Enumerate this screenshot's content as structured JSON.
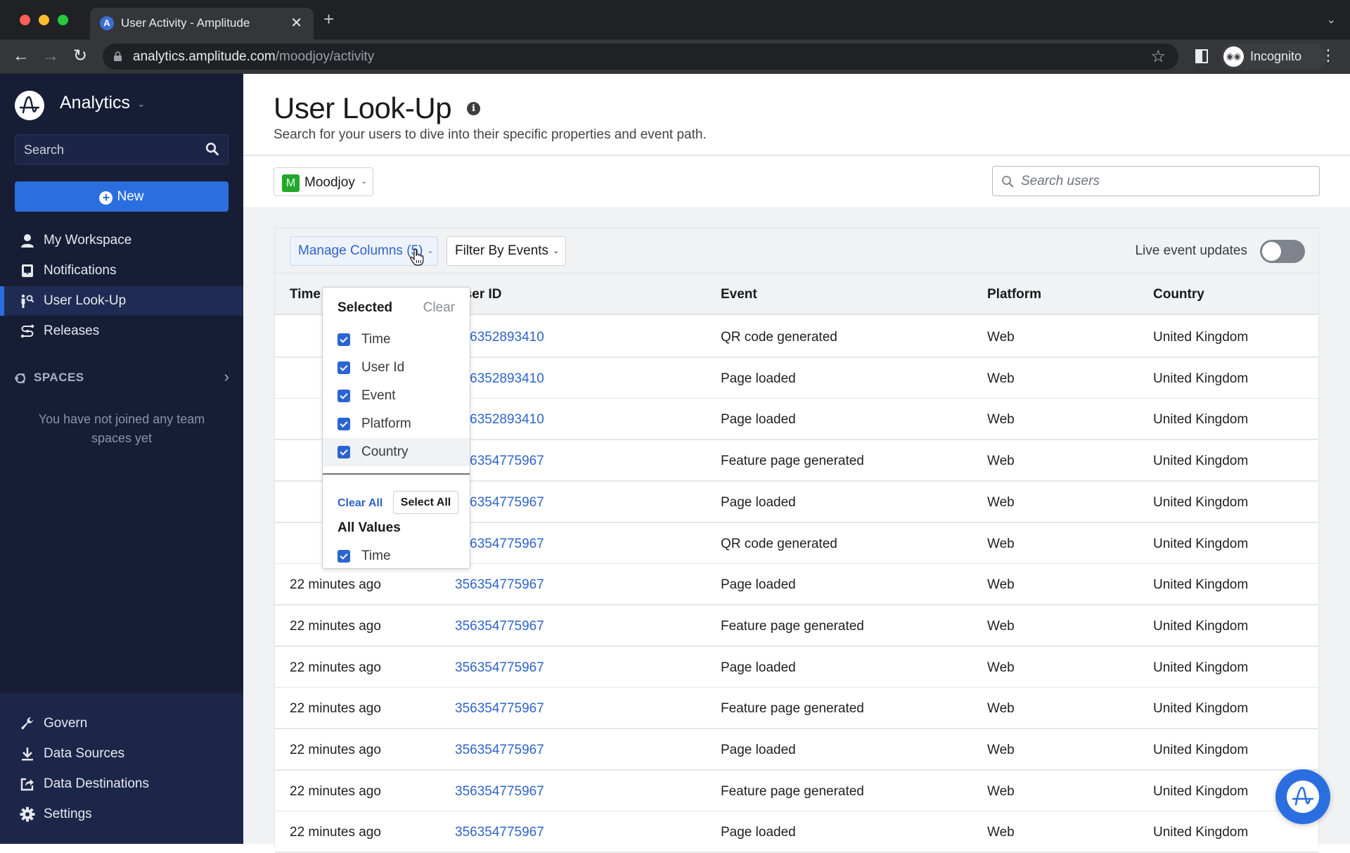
{
  "browser": {
    "tab_title": "User Activity - Amplitude",
    "url_host": "analytics.amplitude.com",
    "url_path": "/moodjoy/activity",
    "profile_label": "Incognito",
    "traffic_colors": {
      "close": "#ff5f57",
      "minimize": "#febc2e",
      "maximize": "#28c840"
    }
  },
  "sidebar": {
    "app_name": "Analytics",
    "search_placeholder": "Search",
    "new_button": "New",
    "nav": [
      {
        "label": "My Workspace",
        "icon": "user-icon"
      },
      {
        "label": "Notifications",
        "icon": "inbox-icon"
      },
      {
        "label": "User Look-Up",
        "icon": "user-search-icon",
        "active": true
      },
      {
        "label": "Releases",
        "icon": "releases-icon"
      }
    ],
    "spaces_label": "SPACES",
    "spaces_empty": "You have not joined any team spaces yet",
    "bottom_nav": [
      {
        "label": "Govern",
        "icon": "wrench-icon"
      },
      {
        "label": "Data Sources",
        "icon": "download-icon"
      },
      {
        "label": "Data Destinations",
        "icon": "export-icon"
      },
      {
        "label": "Settings",
        "icon": "gear-icon"
      }
    ]
  },
  "main": {
    "title": "User Look-Up",
    "subtitle": "Search for your users to dive into their specific properties and event path.",
    "project": {
      "badge": "M",
      "name": "Moodjoy",
      "badge_color": "#22a82a"
    },
    "search_placeholder": "Search users",
    "toolbar": {
      "manage_columns": "Manage Columns (5)",
      "filter_events": "Filter By Events",
      "live_updates_label": "Live event updates",
      "live_updates_on": false
    },
    "columns_dropdown": {
      "selected_title": "Selected",
      "clear": "Clear",
      "selected": [
        "Time",
        "User Id",
        "Event",
        "Platform",
        "Country"
      ],
      "clear_all": "Clear All",
      "select_all": "Select All",
      "all_values_title": "All Values",
      "all_values": [
        "Time"
      ]
    },
    "table": {
      "headers": [
        "Time",
        "User ID",
        "Event",
        "Platform",
        "Country"
      ],
      "rows": [
        [
          "",
          "356352893410",
          "QR code generated",
          "Web",
          "United Kingdom"
        ],
        [
          "",
          "356352893410",
          "Page loaded",
          "Web",
          "United Kingdom"
        ],
        [
          "",
          "356352893410",
          "Page loaded",
          "Web",
          "United Kingdom"
        ],
        [
          "",
          "356354775967",
          "Feature page generated",
          "Web",
          "United Kingdom"
        ],
        [
          "",
          "356354775967",
          "Page loaded",
          "Web",
          "United Kingdom"
        ],
        [
          "",
          "356354775967",
          "QR code generated",
          "Web",
          "United Kingdom"
        ],
        [
          "22 minutes ago",
          "356354775967",
          "Page loaded",
          "Web",
          "United Kingdom"
        ],
        [
          "22 minutes ago",
          "356354775967",
          "Feature page generated",
          "Web",
          "United Kingdom"
        ],
        [
          "22 minutes ago",
          "356354775967",
          "Page loaded",
          "Web",
          "United Kingdom"
        ],
        [
          "22 minutes ago",
          "356354775967",
          "Feature page generated",
          "Web",
          "United Kingdom"
        ],
        [
          "22 minutes ago",
          "356354775967",
          "Page loaded",
          "Web",
          "United Kingdom"
        ],
        [
          "22 minutes ago",
          "356354775967",
          "Feature page generated",
          "Web",
          "United Kingdom"
        ],
        [
          "22 minutes ago",
          "356354775967",
          "Page loaded",
          "Web",
          "United Kingdom"
        ]
      ]
    }
  },
  "colors": {
    "accent": "#2b6ee0",
    "sidebar_bg": "#161d35",
    "link": "#2f64c9"
  }
}
